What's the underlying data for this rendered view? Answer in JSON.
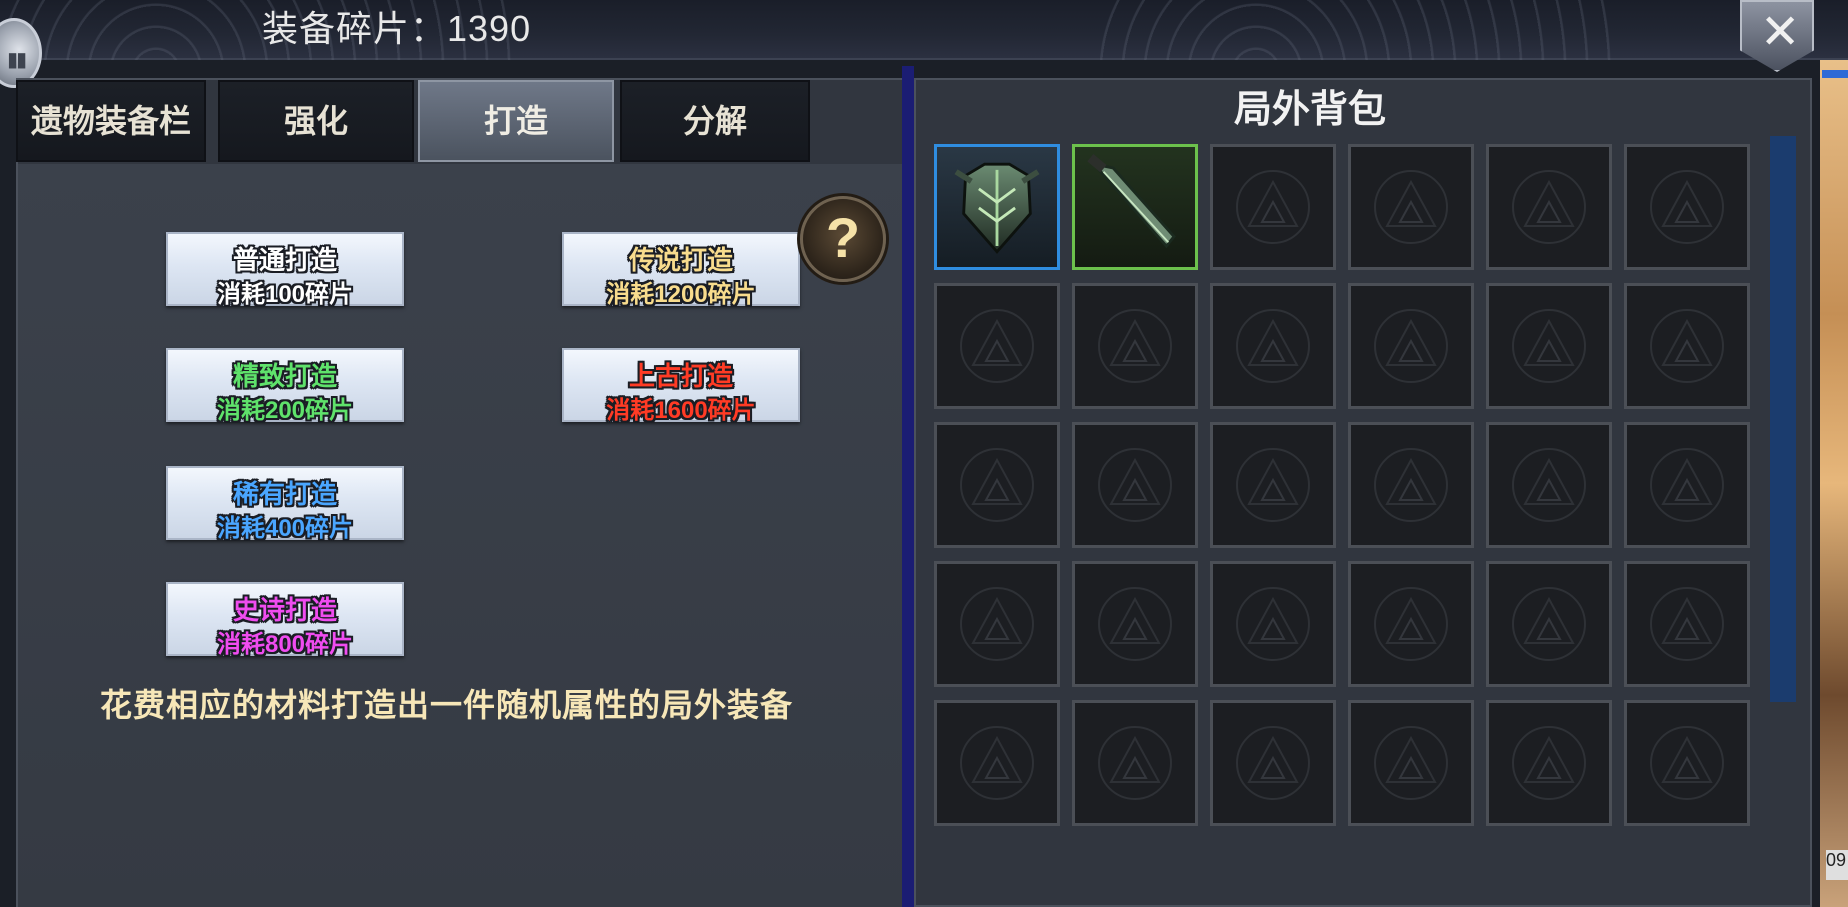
{
  "header": {
    "currency_label": "装备碎片：1390"
  },
  "tabs": [
    {
      "label": "遗物装备栏",
      "active": false
    },
    {
      "label": "强化",
      "active": false
    },
    {
      "label": "打造",
      "active": true
    },
    {
      "label": "分解",
      "active": false
    }
  ],
  "forge_options": [
    {
      "title": "普通打造",
      "cost": "消耗100碎片",
      "color": "#ffffff"
    },
    {
      "title": "精致打造",
      "cost": "消耗200碎片",
      "color": "#5fe26b"
    },
    {
      "title": "稀有打造",
      "cost": "消耗400碎片",
      "color": "#4aa6ff"
    },
    {
      "title": "史诗打造",
      "cost": "消耗800碎片",
      "color": "#f04cf0"
    },
    {
      "title": "传说打造",
      "cost": "消耗1200碎片",
      "color": "#f8dc8d"
    },
    {
      "title": "上古打造",
      "cost": "消耗1600碎片",
      "color": "#ff3b25"
    }
  ],
  "help": {
    "symbol": "?"
  },
  "description": "花费相应的材料打造出一件随机属性的局外装备",
  "bag": {
    "title": "局外背包",
    "items": [
      {
        "slot": 1,
        "icon": "armor-icon",
        "rarity_color": "#2f8de0"
      },
      {
        "slot": 2,
        "icon": "dagger-icon",
        "rarity_color": "#6cc14c"
      }
    ],
    "total_slots_visible": 30
  },
  "close": {
    "symbol": "✕"
  },
  "time_badge": "09"
}
